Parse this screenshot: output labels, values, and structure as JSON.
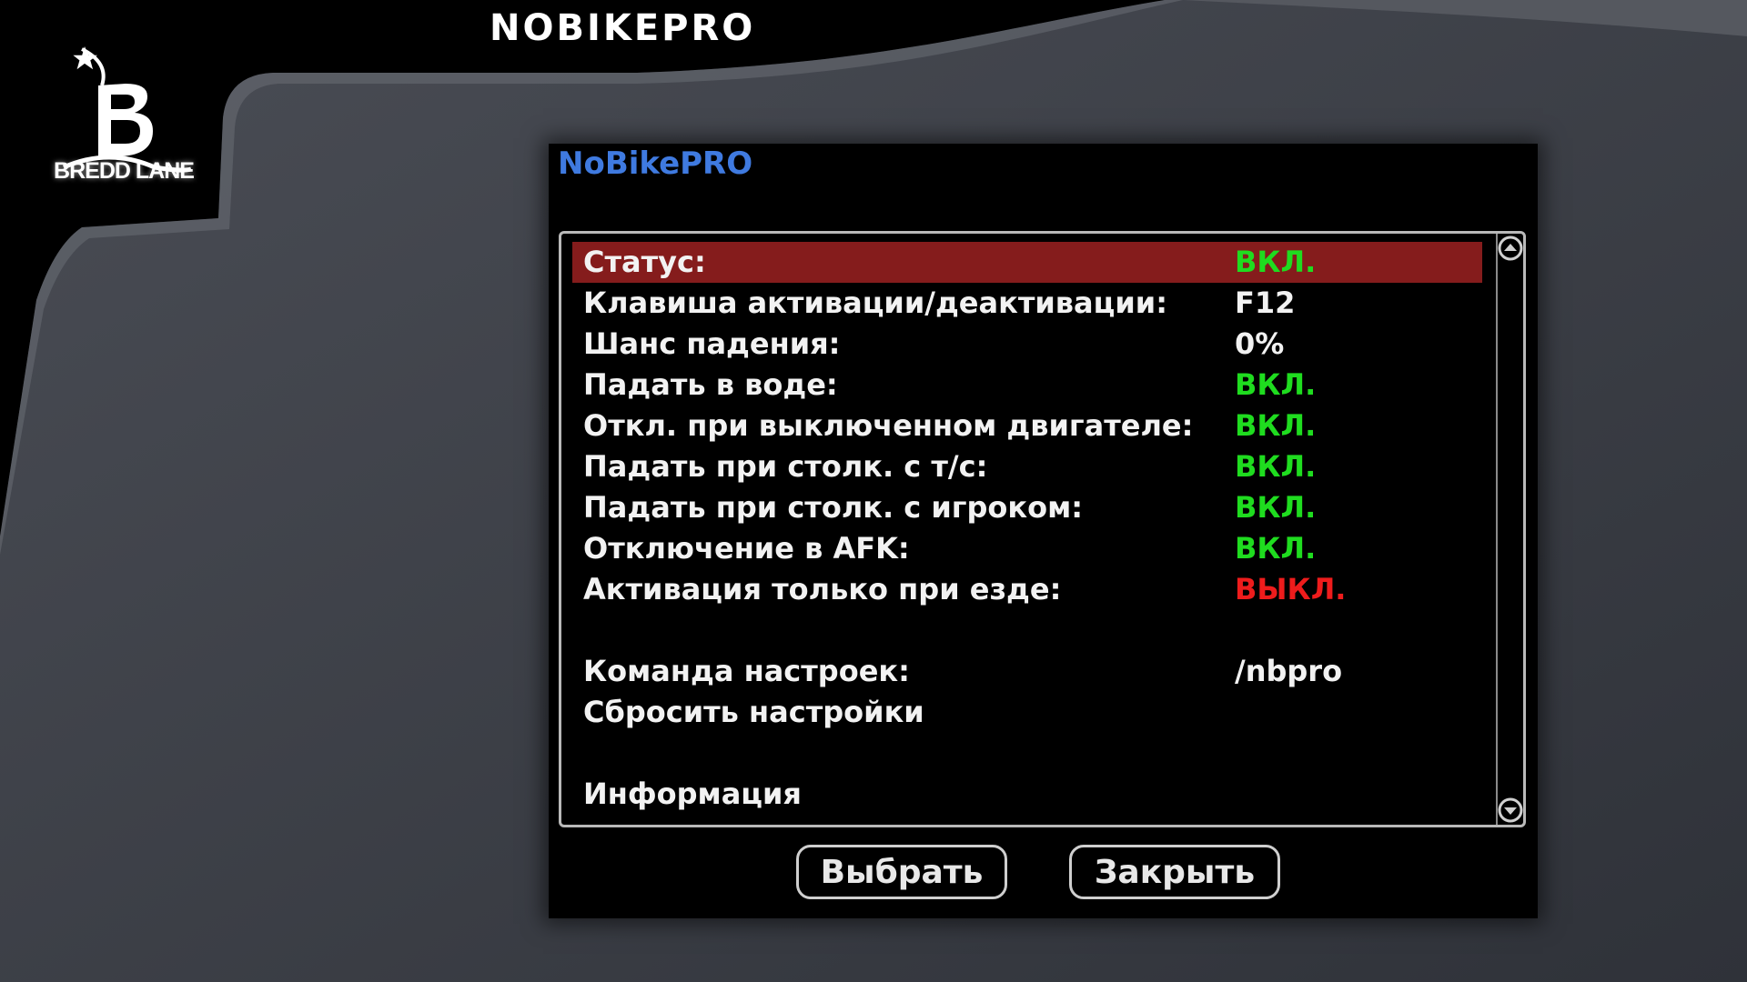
{
  "header": {
    "title": "NOBIKEPRO"
  },
  "logo": {
    "text": "BREDD LANE"
  },
  "dialog": {
    "title": "NoBikePRO",
    "rows": [
      {
        "label": "Статус:",
        "value": "ВКЛ.",
        "state": "on",
        "selected": true
      },
      {
        "label": "Клавиша активации/деактивации:",
        "value": "F12",
        "state": "plain"
      },
      {
        "label": "Шанс падения:",
        "value": "0%",
        "state": "plain"
      },
      {
        "label": "Падать в воде:",
        "value": "ВКЛ.",
        "state": "on"
      },
      {
        "label": "Откл. при выключенном двигателе:",
        "value": "ВКЛ.",
        "state": "on"
      },
      {
        "label": "Падать при столк. с т/с:",
        "value": "ВКЛ.",
        "state": "on"
      },
      {
        "label": "Падать при столк. с игроком:",
        "value": "ВКЛ.",
        "state": "on"
      },
      {
        "label": "Отключение в AFK:",
        "value": "ВКЛ.",
        "state": "on"
      },
      {
        "label": "Активация только при езде:",
        "value": "ВЫКЛ.",
        "state": "off"
      },
      {
        "label": "Команда настроек:",
        "value": "/nbpro",
        "state": "plain"
      },
      {
        "label": "Сбросить настройки"
      },
      {
        "label": "Информация"
      }
    ],
    "buttons": {
      "select": "Выбрать",
      "close": "Закрыть"
    }
  },
  "colors": {
    "title": "#3f7ae0",
    "on": "#1fdc1f",
    "off": "#ee1c1c",
    "selected_row": "#851c1c"
  },
  "icons": [
    "scroll-up-arrow-icon",
    "scroll-down-arrow-icon",
    "bredd-lane-logo-icon"
  ]
}
